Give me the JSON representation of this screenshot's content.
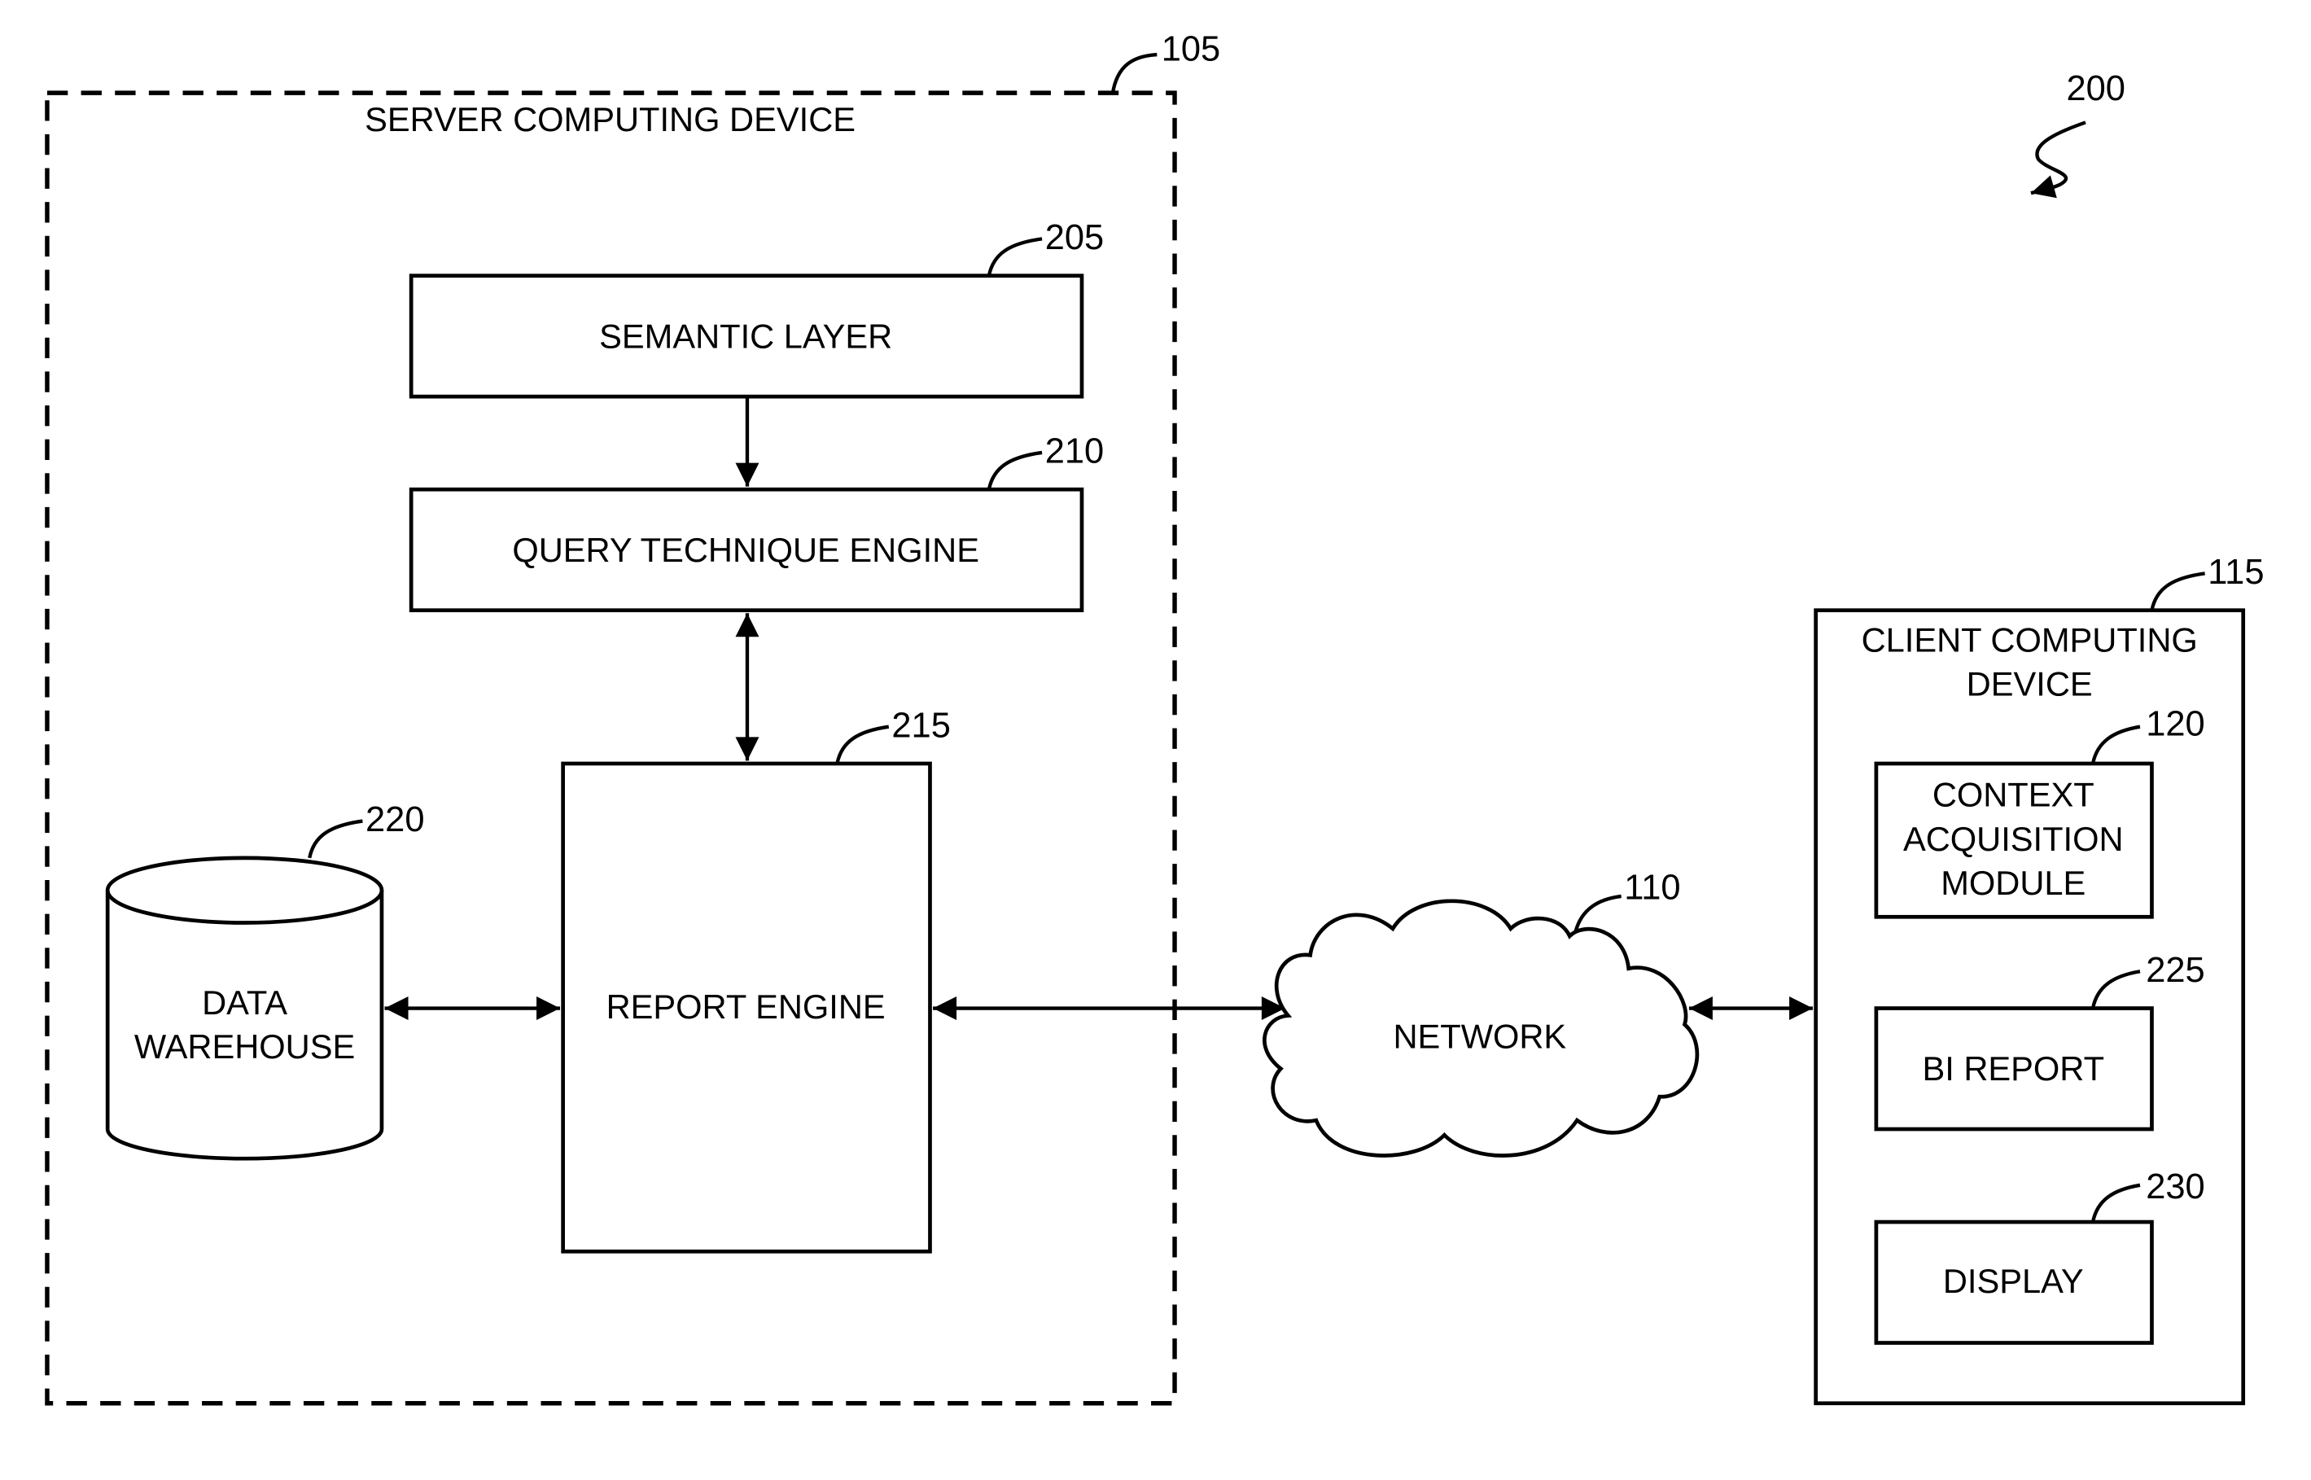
{
  "figure_ref": "200",
  "server": {
    "label": "SERVER COMPUTING DEVICE",
    "ref": "105"
  },
  "semantic_layer": {
    "label": "SEMANTIC LAYER",
    "ref": "205"
  },
  "query_engine": {
    "label": "QUERY TECHNIQUE ENGINE",
    "ref": "210"
  },
  "report_engine": {
    "label": "REPORT ENGINE",
    "ref": "215"
  },
  "data_warehouse": {
    "line1": "DATA",
    "line2": "WAREHOUSE",
    "ref": "220"
  },
  "network": {
    "label": "NETWORK",
    "ref": "110"
  },
  "client": {
    "line1": "CLIENT COMPUTING",
    "line2": "DEVICE",
    "ref": "115"
  },
  "context_module": {
    "line1": "CONTEXT",
    "line2": "ACQUISITION",
    "line3": "MODULE",
    "ref": "120"
  },
  "bi_report": {
    "label": "BI REPORT",
    "ref": "225"
  },
  "display": {
    "label": "DISPLAY",
    "ref": "230"
  }
}
